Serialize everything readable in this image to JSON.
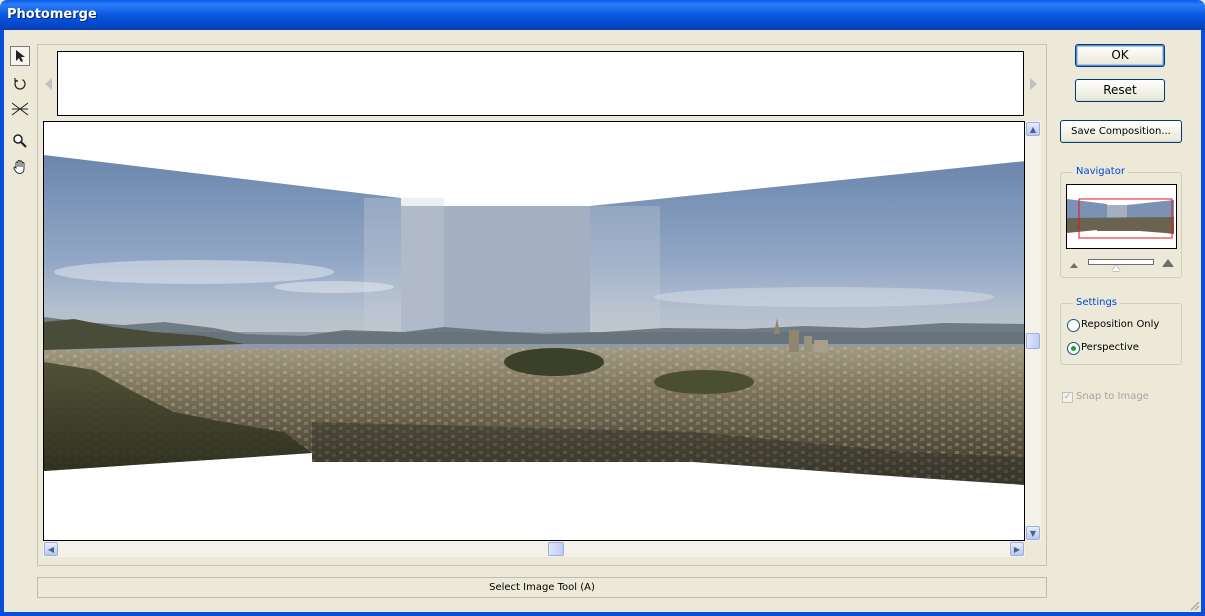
{
  "window": {
    "title": "Photomerge"
  },
  "tools": [
    {
      "name": "select-image-tool",
      "icon": "arrow-pointer-icon",
      "active": true
    },
    {
      "name": "rotate-image-tool",
      "icon": "rotate-icon"
    },
    {
      "name": "set-vanishing-point-tool",
      "icon": "vanishing-point-icon"
    },
    {
      "name": "zoom-tool",
      "icon": "magnifier-icon"
    },
    {
      "name": "move-view-tool",
      "icon": "hand-icon"
    }
  ],
  "buttons": {
    "ok": "OK",
    "reset": "Reset",
    "save": "Save Composition..."
  },
  "navigator": {
    "label": "Navigator"
  },
  "settings": {
    "label": "Settings",
    "reposition": "Reposition Only",
    "perspective": "Perspective",
    "selected": "Perspective"
  },
  "snap": {
    "label": "Snap to Image",
    "checked": true,
    "enabled": false
  },
  "status": {
    "text": "Select Image Tool (A)"
  },
  "colors": {
    "title_bar": "#0a5fe8",
    "dialog_bg": "#ece9d8",
    "navigator_view_box": "#e8101a",
    "group_label": "#0046d5"
  }
}
